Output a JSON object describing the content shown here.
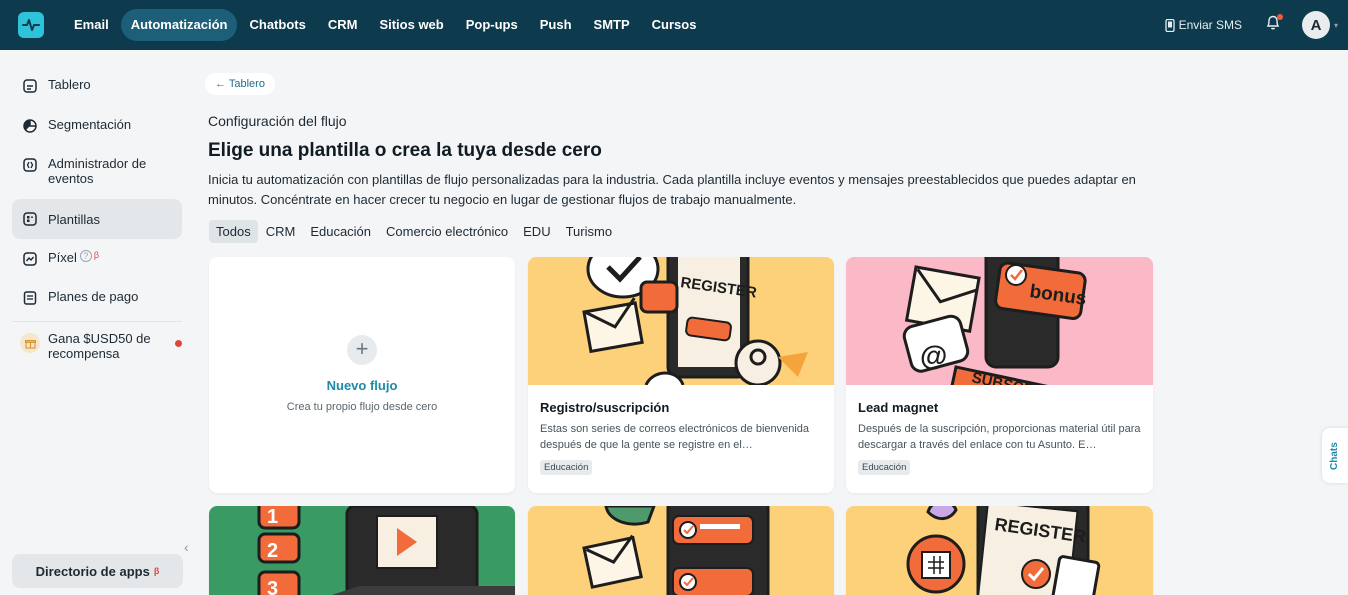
{
  "topnav": {
    "items": [
      "Email",
      "Automatización",
      "Chatbots",
      "CRM",
      "Sitios web",
      "Pop-ups",
      "Push",
      "SMTP",
      "Cursos"
    ],
    "active_index": 1,
    "send_sms": "Enviar SMS",
    "avatar_initial": "A"
  },
  "sidebar": {
    "items": [
      {
        "label": "Tablero",
        "icon": "dashboard-icon"
      },
      {
        "label": "Segmentación",
        "icon": "pie-chart-icon"
      },
      {
        "label": "Administrador de eventos",
        "icon": "event-icon"
      },
      {
        "label": "Plantillas",
        "icon": "templates-icon"
      },
      {
        "label": "Píxel",
        "icon": "pixel-icon"
      },
      {
        "label": "Planes de pago",
        "icon": "payment-plans-icon"
      },
      {
        "label": "Gana $USD50 de recompensa",
        "icon": "gift-icon"
      }
    ],
    "active_index": 3,
    "help_symbol": "?",
    "beta_symbol": "β",
    "app_directory": "Directorio de apps"
  },
  "main": {
    "back_link": "← Tablero",
    "eyebrow": "Configuración del flujo",
    "title": "Elige una plantilla o crea la tuya desde cero",
    "description": "Inicia tu automatización con plantillas de flujo personalizadas para la industria. Cada plantilla incluye eventos y mensajes preestablecidos que puedes adaptar en minutos. Concéntrate en hacer crecer tu negocio en lugar de gestionar flujos de trabajo manualmente.",
    "tabs": [
      "Todos",
      "CRM",
      "Educación",
      "Comercio electrónico",
      "EDU",
      "Turismo"
    ],
    "active_tab": 0
  },
  "new_flow": {
    "plus": "+",
    "title": "Nuevo flujo",
    "subtitle": "Crea tu propio flujo desde cero"
  },
  "templates": [
    {
      "title": "Registro/suscripción",
      "description": "Estas son series de correos electrónicos de bienvenida después de que la gente se registre en el…",
      "tag": "Educación",
      "illustration_text": "REGISTER",
      "bg": "#fdd17a"
    },
    {
      "title": "Lead magnet",
      "description": "Después de la suscripción, proporcionas material útil para descargar a través del enlace con tu Asunto. E…",
      "tag": "Educación",
      "illustration_text_1": "bonus",
      "illustration_text_2": "SUBSCRI",
      "bg": "#fbb8c6"
    }
  ],
  "bottom_row": {
    "card1_numbers": [
      "1",
      "2",
      "3"
    ],
    "card3_text": "REGISTER",
    "colors": [
      "#3a9a64",
      "#fdd17a",
      "#fdd17a"
    ]
  },
  "chats_tab": "Chats",
  "colors": {
    "topbar": "#0e3a4d",
    "accent": "#1d8aa8",
    "orange": "#f26b3a"
  }
}
